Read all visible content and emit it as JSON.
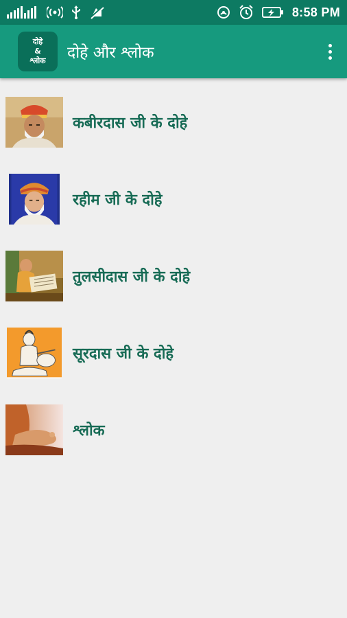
{
  "status_bar": {
    "time": "8:58 PM",
    "left_icons": [
      "signal-bars-icon",
      "hotspot-icon",
      "usb-icon",
      "no-notifications-icon"
    ],
    "right_icons": [
      "nfc-icon",
      "alarm-icon",
      "battery-charging-icon"
    ]
  },
  "app_bar": {
    "logo_line1": "दोहे",
    "logo_line2": "&",
    "logo_line3": "श्लोक",
    "title": "दोहे और श्लोक",
    "menu_icon": "more-vertical-icon"
  },
  "colors": {
    "status_bar": "#0d7a62",
    "app_bar": "#169a7e",
    "label_text": "#176b55",
    "background": "#efefef"
  },
  "items": [
    {
      "label": "कबीरदास जी के दोहे",
      "thumb_icon": "kabirdas-portrait"
    },
    {
      "label": "रहीम जी के दोहे",
      "thumb_icon": "rahim-portrait"
    },
    {
      "label": "तुलसीदास जी के दोहे",
      "thumb_icon": "tulsidas-portrait"
    },
    {
      "label": "सूरदास जी के दोहे",
      "thumb_icon": "surdas-portrait"
    },
    {
      "label": "श्लोक",
      "thumb_icon": "meditation-image"
    }
  ]
}
